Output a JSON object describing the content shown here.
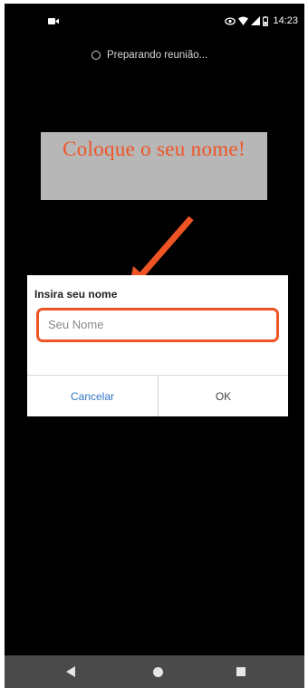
{
  "status_bar": {
    "time": "14:23",
    "icons": [
      "video-icon",
      "eye-icon",
      "wifi-icon",
      "signal-icon",
      "battery-icon"
    ]
  },
  "loading": {
    "text": "Preparando reunião...",
    "icon": "spinner-icon"
  },
  "annotation": {
    "text": "Coloque o seu nome!",
    "colors": {
      "text": "#ef5425",
      "box": "#b7b7b7",
      "arrow": "#ef5425"
    }
  },
  "dialog": {
    "title": "Insira seu nome",
    "input": {
      "value": "",
      "placeholder": "Seu Nome"
    },
    "cancel_label": "Cancelar",
    "ok_label": "OK",
    "colors": {
      "highlight_border": "#ef5425",
      "cancel_text": "#2f73c3"
    }
  },
  "nav_bar": {
    "icons": [
      "back-icon",
      "home-icon",
      "recents-icon"
    ]
  }
}
